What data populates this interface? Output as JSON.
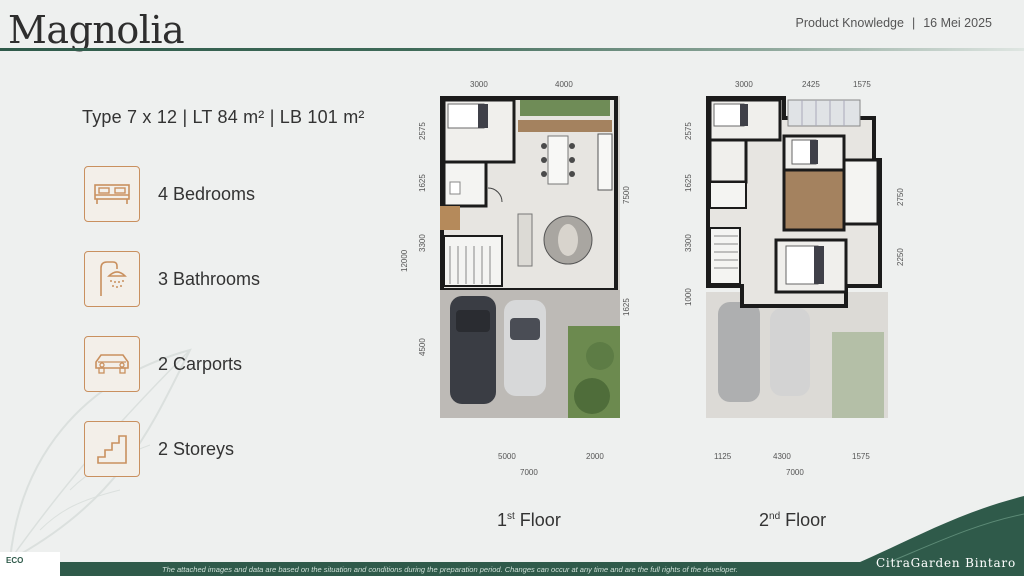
{
  "header": {
    "title": "Magnolia",
    "subtitle": "Product Knowledge",
    "separator": "|",
    "date": "16 Mei 2025"
  },
  "type_line": "Type 7 x 12  |  LT 84 m²  |  LB 101 m²",
  "features": [
    {
      "label": "4 Bedrooms",
      "icon": "bed-icon"
    },
    {
      "label": "3 Bathrooms",
      "icon": "shower-icon"
    },
    {
      "label": "2 Carports",
      "icon": "car-icon"
    },
    {
      "label": "2 Storeys",
      "icon": "stairs-icon"
    }
  ],
  "floor1": {
    "label_num": "1",
    "label_sup": "st",
    "label_text": " Floor",
    "dims_top": [
      "3000",
      "4000"
    ],
    "dims_left": [
      "2575",
      "1625",
      "3300",
      "4500"
    ],
    "dims_outer_left": "12000",
    "dims_right": [
      "7500",
      "1625"
    ],
    "dims_bottom": [
      "5000",
      "2000"
    ],
    "dims_bottom_total": "7000"
  },
  "floor2": {
    "label_num": "2",
    "label_sup": "nd",
    "label_text": " Floor",
    "dims_top": [
      "3000",
      "2425",
      "1575"
    ],
    "dims_left": [
      "2575",
      "1625",
      "3300",
      "1000"
    ],
    "dims_right": [
      "2750",
      "2250"
    ],
    "dims_bottom": [
      "1125",
      "4300",
      "1575"
    ],
    "dims_bottom_total": "7000"
  },
  "footer": {
    "disclaimer": "The attached images and data are based on the situation and conditions during the preparation period. Changes can occur at any time and are the full rights of the developer.",
    "brand": "CitraGarden Bintaro",
    "eco": "ECO"
  },
  "colors": {
    "accent_green": "#2f5a4a",
    "icon_border": "#c9905f"
  }
}
